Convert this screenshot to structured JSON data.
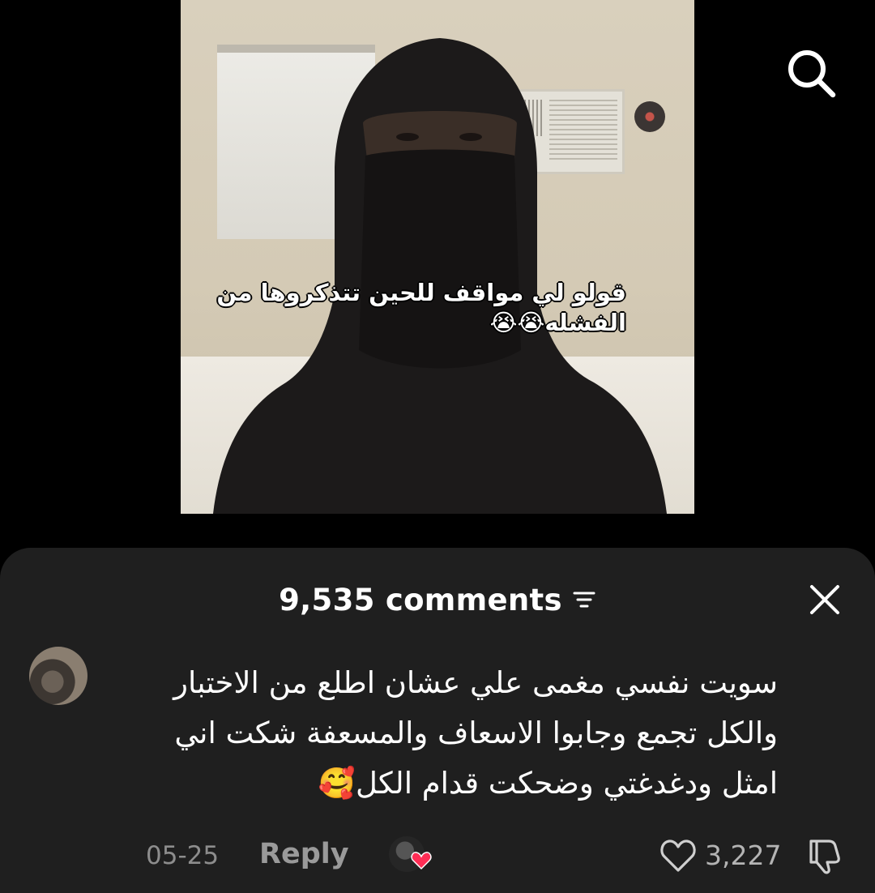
{
  "video": {
    "caption_line1": "قولو لي مواقف للحين تتذكروها من",
    "caption_line2": "الفشله😭😭"
  },
  "top_bar": {
    "search_icon": "search-icon"
  },
  "comments": {
    "count_label": "9,535 comments",
    "sort_icon": "sort-icon",
    "close_icon": "close-icon",
    "items": [
      {
        "text_line1": "سويت نفسي مغمى علي عشان اطلع من الاختبار",
        "text_line2": "والكل تجمع وجابوا الاسعاف والمسعفة شكت اني",
        "text_line3": "امثل ودغدغتي وضحكت قدام الكل🥰",
        "date": "05-25",
        "reply_label": "Reply",
        "likes": "3,227"
      }
    ]
  },
  "colors": {
    "sheet_bg": "#1f1f1f",
    "heart_badge": "#ff2d55",
    "muted_text": "#8d8d8d"
  }
}
